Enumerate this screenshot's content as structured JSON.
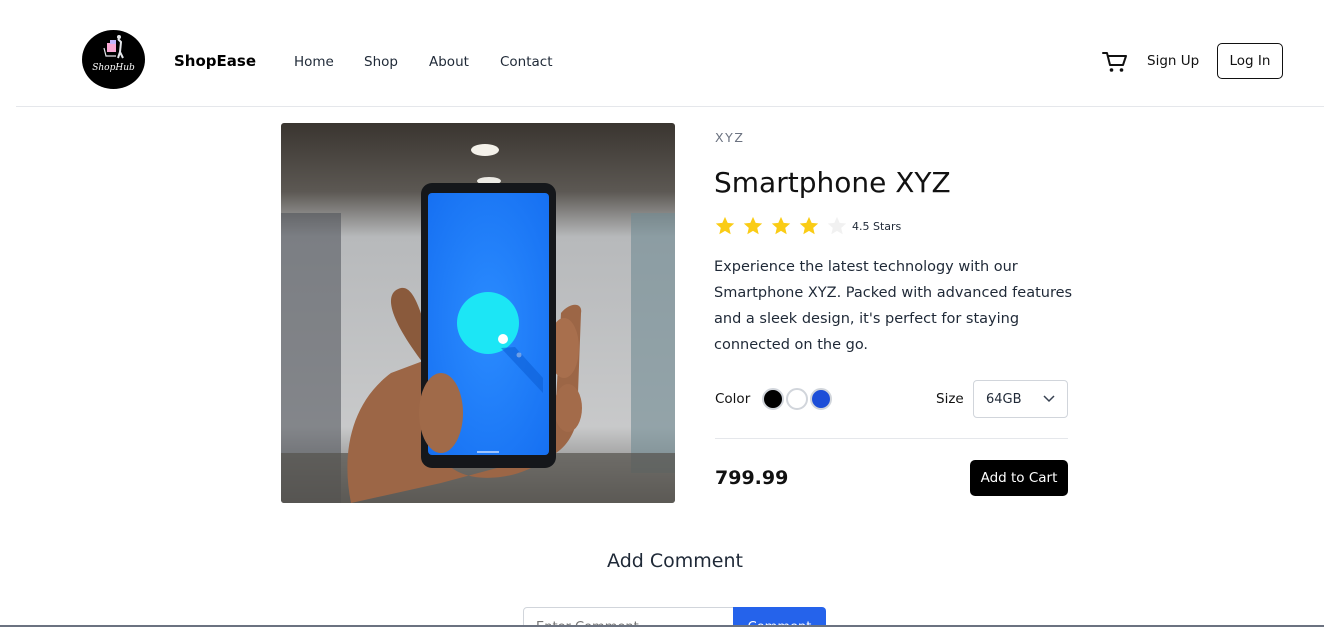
{
  "header": {
    "logo_text": "ShopHub",
    "brand": "ShopEase",
    "nav": [
      {
        "label": "Home"
      },
      {
        "label": "Shop"
      },
      {
        "label": "About"
      },
      {
        "label": "Contact"
      }
    ],
    "cart_icon": "shopping-cart-icon",
    "signup_label": "Sign Up",
    "login_label": "Log In"
  },
  "product": {
    "brand": "XYZ",
    "title": "Smartphone XYZ",
    "rating": 4.5,
    "rating_text": "4.5 Stars",
    "star_color": "#facc15",
    "description": "Experience the latest technology with our Smartphone XYZ. Packed with advanced features and a sleek design, it's perfect for staying connected on the go.",
    "color_label": "Color",
    "colors": [
      "#000000",
      "#ffffff",
      "#1d4ed8"
    ],
    "size_label": "Size",
    "size_selected": "64GB",
    "price": "799.99",
    "add_to_cart_label": "Add to Cart"
  },
  "comments": {
    "heading": "Add Comment",
    "input_placeholder": "Enter Comment",
    "submit_label": "Comment"
  }
}
